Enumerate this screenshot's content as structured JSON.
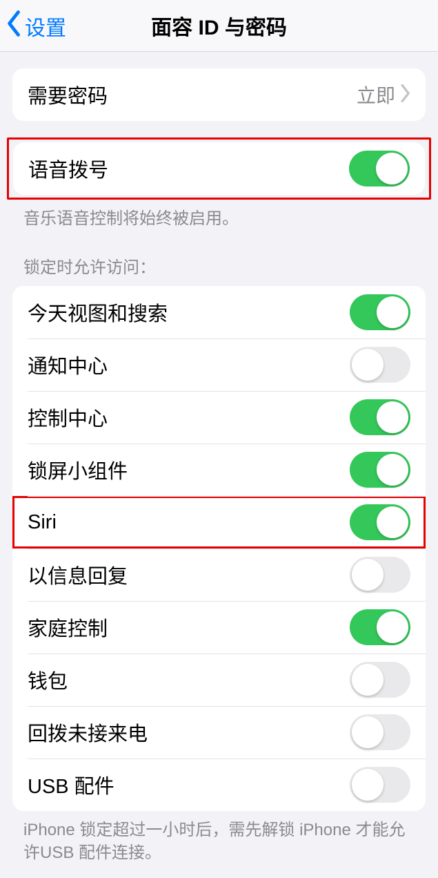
{
  "header": {
    "back_label": "设置",
    "title": "面容 ID 与密码"
  },
  "require_passcode": {
    "label": "需要密码",
    "value": "立即"
  },
  "voice_dial": {
    "label": "语音拨号",
    "footer": "音乐语音控制将始终被启用。"
  },
  "lock_access": {
    "section_title": "锁定时允许访问：",
    "items": [
      {
        "label": "今天视图和搜索",
        "on": true
      },
      {
        "label": "通知中心",
        "on": false
      },
      {
        "label": "控制中心",
        "on": true
      },
      {
        "label": "锁屏小组件",
        "on": true
      },
      {
        "label": "Siri",
        "on": true,
        "highlighted": true
      },
      {
        "label": "以信息回复",
        "on": false
      },
      {
        "label": "家庭控制",
        "on": true
      },
      {
        "label": "钱包",
        "on": false
      },
      {
        "label": "回拨未接来电",
        "on": false
      },
      {
        "label": "USB 配件",
        "on": false
      }
    ],
    "footer": "iPhone 锁定超过一小时后，需先解锁 iPhone 才能允许USB 配件连接。"
  }
}
